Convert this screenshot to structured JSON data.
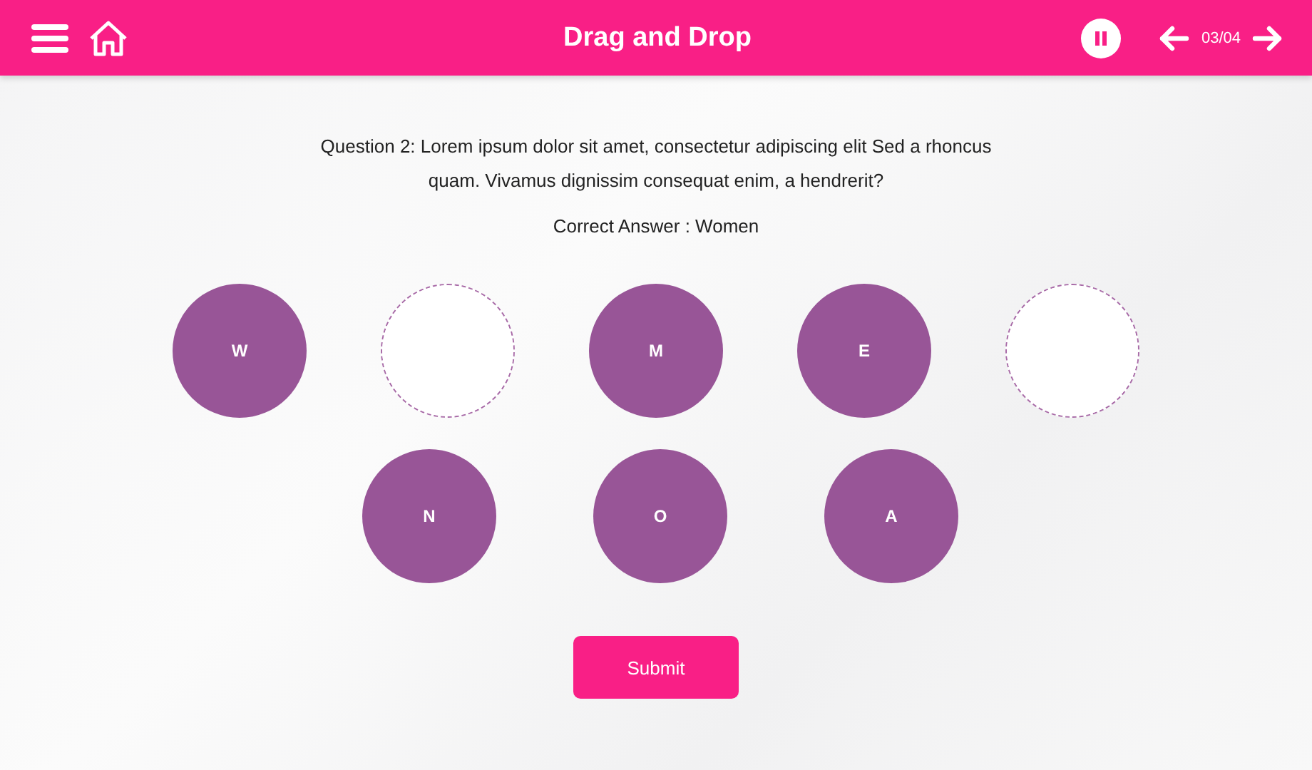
{
  "header": {
    "title": "Drag and Drop",
    "counter": "03/04"
  },
  "question": "Question 2: Lorem ipsum dolor sit amet, consectetur adipiscing elit Sed a rhoncus quam. Vivamus dignissim consequat enim, a hendrerit?",
  "correct_answer": "Correct Answer : Women",
  "slots": [
    {
      "kind": "filled",
      "letter": "W"
    },
    {
      "kind": "empty"
    },
    {
      "kind": "filled",
      "letter": "M"
    },
    {
      "kind": "filled",
      "letter": "E"
    },
    {
      "kind": "empty"
    }
  ],
  "tiles": [
    "N",
    "O",
    "A"
  ],
  "submit": "Submit"
}
